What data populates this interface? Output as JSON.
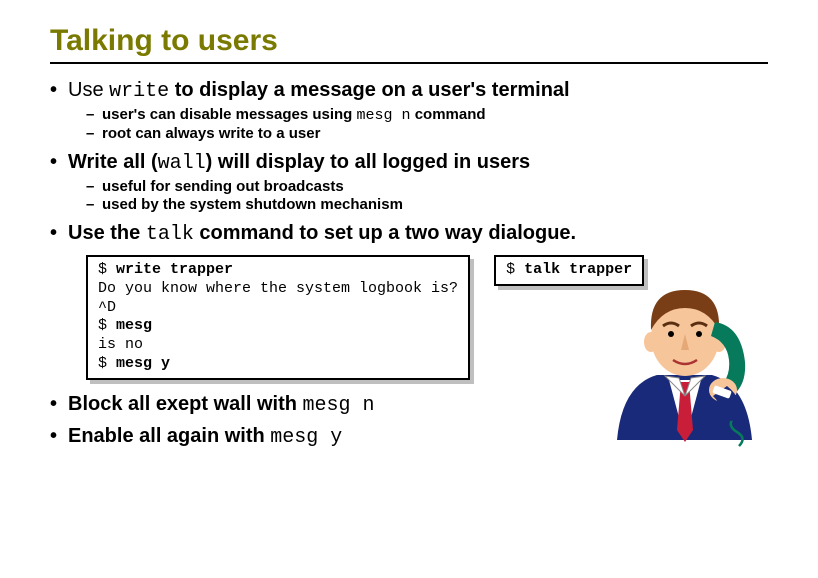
{
  "title": "Talking to users",
  "bullets": [
    {
      "prefix1": "Use ",
      "cmd1": "write",
      "rest1": " to display a message on a user's terminal",
      "subs": [
        {
          "prefix": "user's can disable messages using ",
          "cmd": "mesg n",
          "rest": " command"
        },
        {
          "prefix": "root can always write to a user",
          "cmd": "",
          "rest": ""
        }
      ]
    },
    {
      "prefix1": "Write all (",
      "cmd1": "wall",
      "rest1": ") will display to all logged in users",
      "subs": [
        {
          "prefix": "useful for sending out broadcasts",
          "cmd": "",
          "rest": ""
        },
        {
          "prefix": "used by the system shutdown mechanism",
          "cmd": "",
          "rest": ""
        }
      ]
    },
    {
      "prefix1": "Use the ",
      "cmd1": "talk",
      "rest1": " command to set up a two way dialogue.",
      "subs": []
    }
  ],
  "code1": {
    "l1p": "$ ",
    "l1c": "write trapper",
    "l2": "Do you know where the system logbook is?",
    "l3": "^D",
    "l4p": "$ ",
    "l4c": "mesg",
    "l5": "is no",
    "l6p": "$ ",
    "l6c": "mesg y"
  },
  "code2": {
    "l1p": "$ ",
    "l1c": "talk trapper"
  },
  "bullets2": [
    {
      "prefix": "Block all exept wall with ",
      "cmd": "mesg n"
    },
    {
      "prefix": "Enable all again with ",
      "cmd": "mesg y"
    }
  ],
  "dot": "•",
  "dash": "–"
}
